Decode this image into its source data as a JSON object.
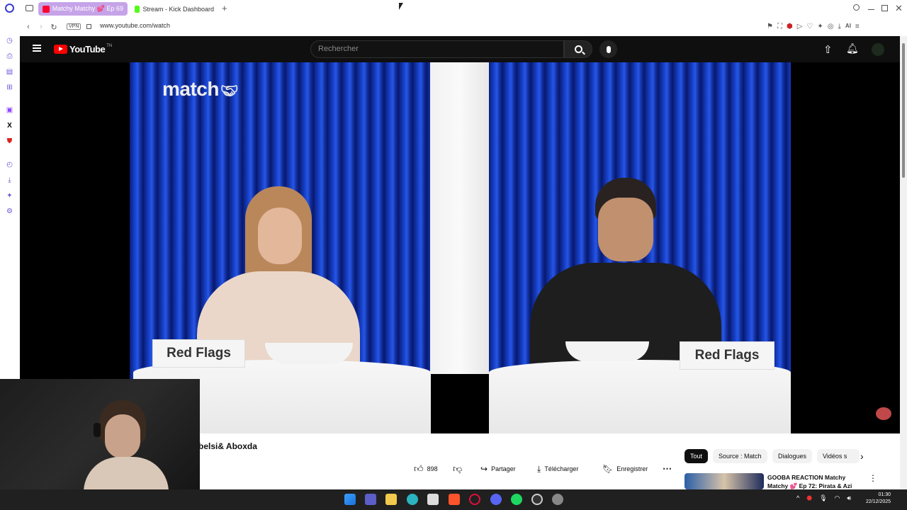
{
  "browser": {
    "tabs": [
      {
        "label": "Matchy Matchy 💕 Ep 69",
        "favicon_color": "#ff0033",
        "active": true
      },
      {
        "label": "Stream - Kick Dashboard",
        "favicon_color": "#53fc18",
        "active": false
      }
    ],
    "url": "www.youtube.com/watch",
    "vpn_label": "VPN",
    "new_tab": "+"
  },
  "youtube": {
    "logo_text": "YouTube",
    "logo_suffix": "TN",
    "search_placeholder": "Rechercher",
    "brand_color": "#ff0000"
  },
  "video": {
    "watermark": "match",
    "sign_left": "Red Flags",
    "sign_right": "Red Flags"
  },
  "below_video": {
    "title": "belsi& Aboxda",
    "like_count": "898",
    "share_label": "Partager",
    "download_label": "Télécharger",
    "save_label": "Enregistrer",
    "more_label": "⋯"
  },
  "chips": [
    "Tout",
    "Source : Match",
    "Dialogues",
    "Vidéos s"
  ],
  "recommendation": {
    "title_line1": "GOOBA REACTION Matchy",
    "title_line2": "Matchy 💕 Ep 72: Pirata & Azi"
  },
  "taskbar": {
    "time": "01:30",
    "date": "22/12/2025"
  }
}
